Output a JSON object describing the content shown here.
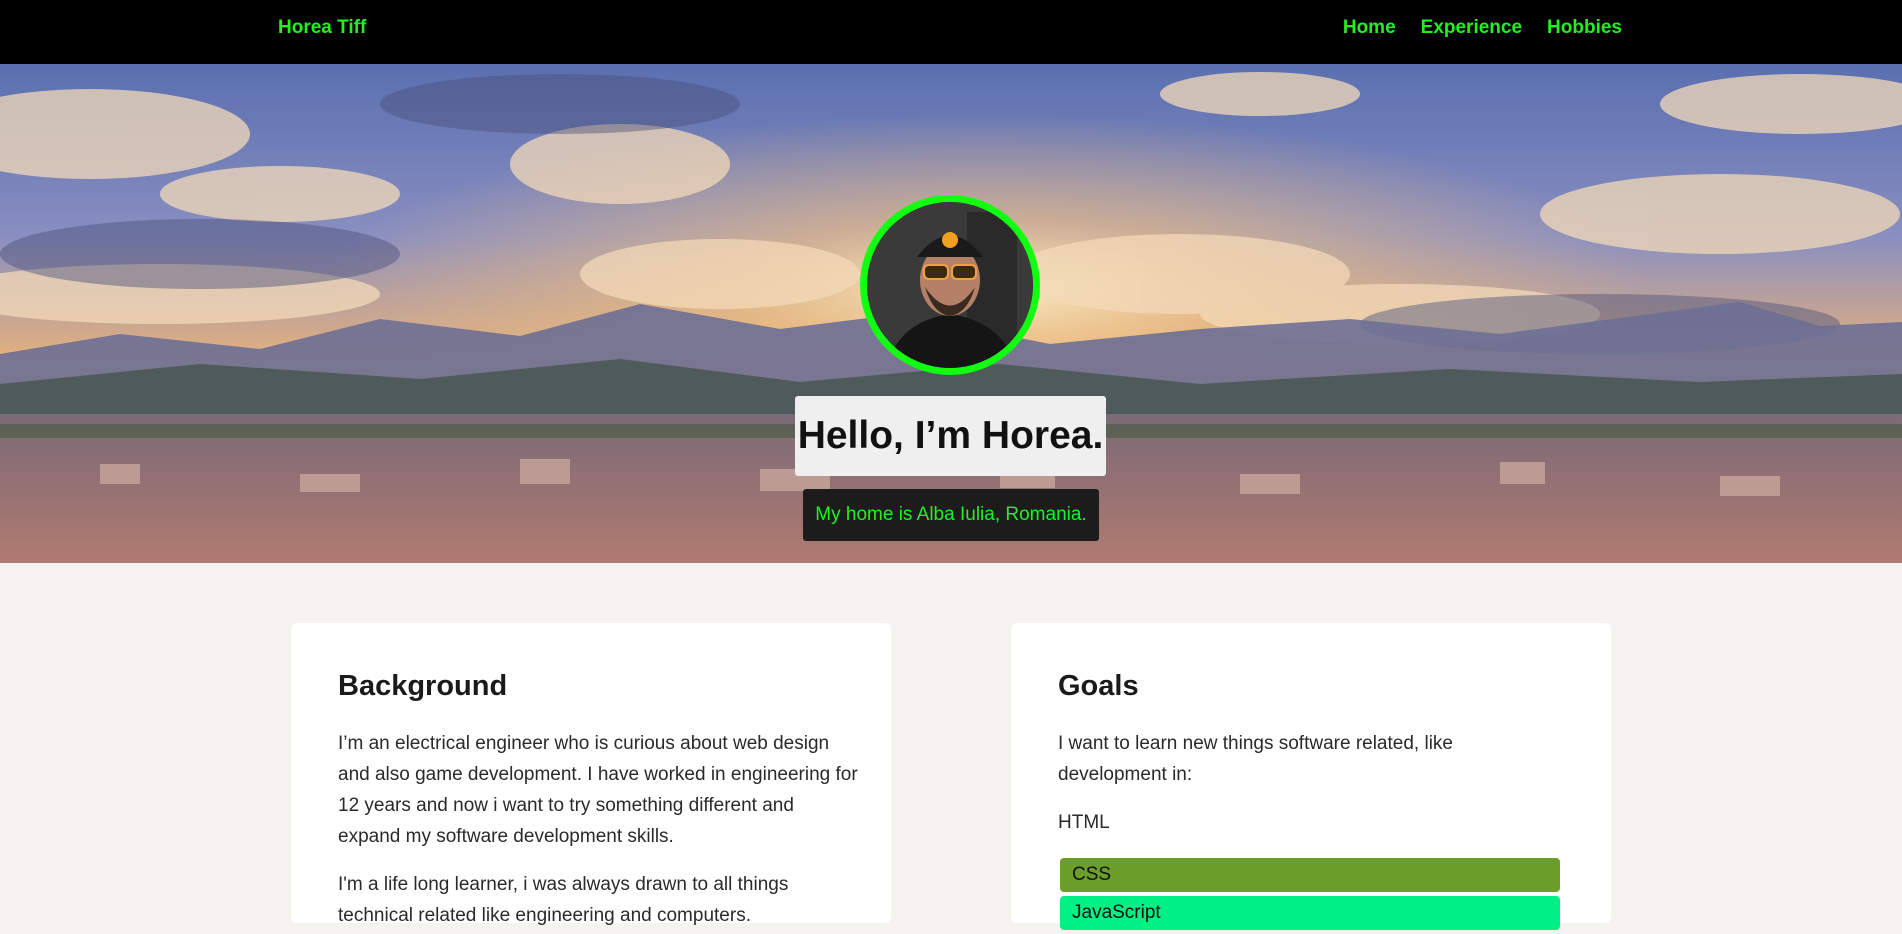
{
  "nav": {
    "brand": "Horea Tiff",
    "links": [
      "Home",
      "Experience",
      "Hobbies"
    ]
  },
  "hero": {
    "title": "Hello, I’m Horea.",
    "subtitle": "My home is Alba Iulia, Romania."
  },
  "background": {
    "heading": "Background",
    "p1": "I’m an electrical engineer who is curious about web design and also game development. I have worked in engineering for 12 years and now i want to try something different and expand my software development skills.",
    "p2": "I'm a life long learner, i was always drawn to all things technical related like engineering and computers."
  },
  "goals": {
    "heading": "Goals",
    "p1": "I want to learn new things software related, like development in:",
    "html_label": "HTML",
    "skills": [
      {
        "label": "CSS",
        "color": "#6b9e2a"
      },
      {
        "label": "JavaScript",
        "color": "#00f084"
      }
    ]
  },
  "colors": {
    "accent": "#22f022",
    "navbar": "#000000",
    "page_bg": "#f5f3ef"
  }
}
